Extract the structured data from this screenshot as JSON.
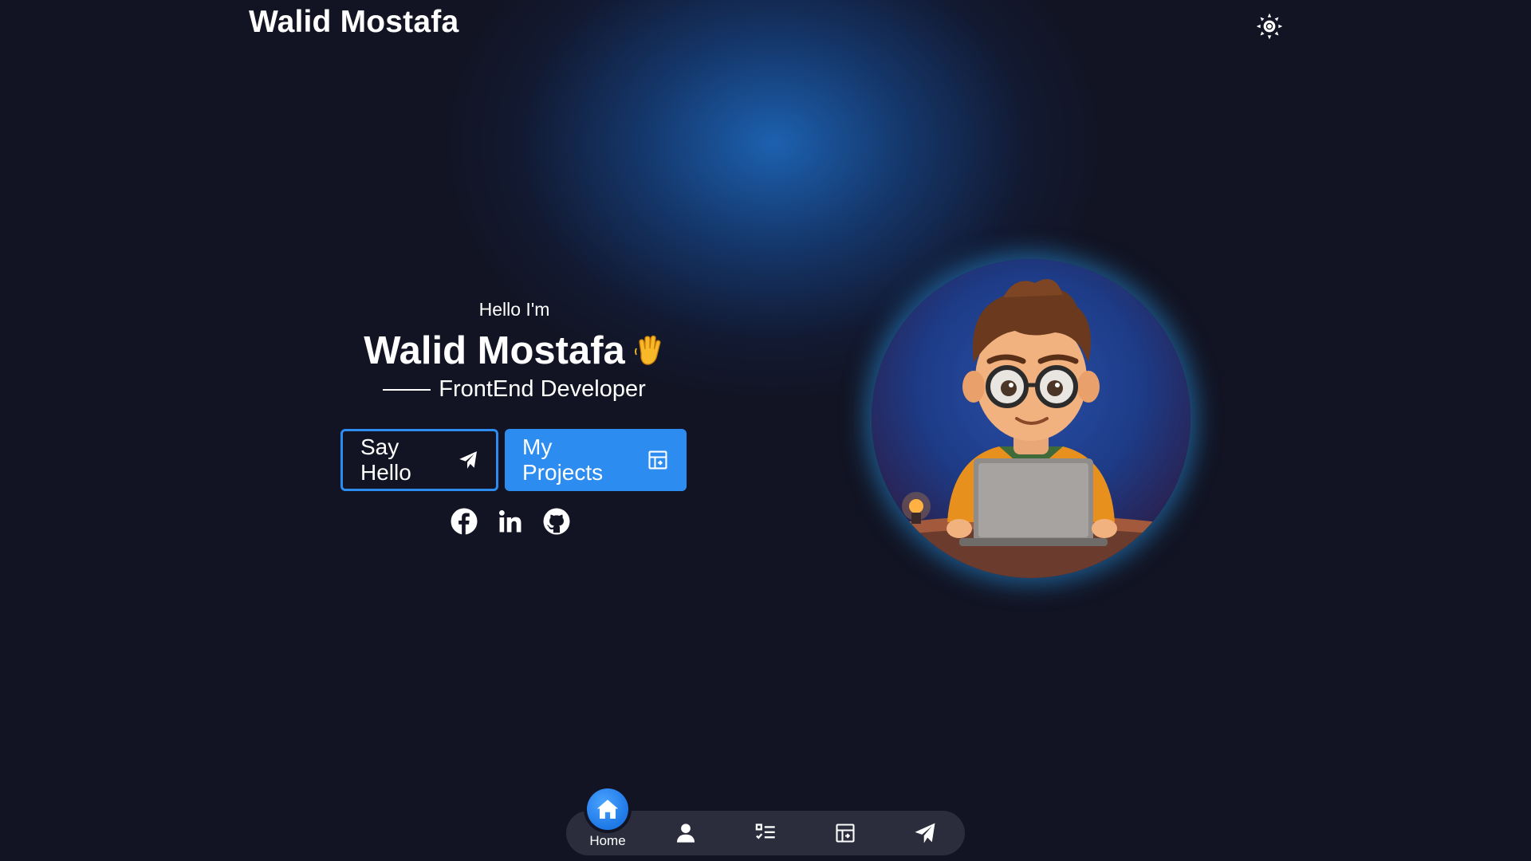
{
  "header": {
    "brand": "Walid Mostafa",
    "theme_toggle_icon": "sun-icon"
  },
  "hero": {
    "greeting": "Hello I'm",
    "name": "Walid Mostafa",
    "wave_icon": "waving-hand-icon",
    "role": "FrontEnd Developer",
    "buttons": [
      {
        "label": "Say Hello",
        "icon": "paper-plane-icon"
      },
      {
        "label": "My Projects",
        "icon": "projects-icon"
      }
    ],
    "socials": [
      "facebook-icon",
      "linkedin-icon",
      "github-icon"
    ]
  },
  "avatar": {
    "icon": "developer-avatar"
  },
  "bottom_nav": {
    "items": [
      {
        "label": "Home",
        "icon": "home-icon",
        "active": true
      },
      {
        "label": "",
        "icon": "user-icon"
      },
      {
        "label": "",
        "icon": "checklist-icon"
      },
      {
        "label": "",
        "icon": "projects-icon"
      },
      {
        "label": "",
        "icon": "paper-plane-icon"
      }
    ]
  },
  "colors": {
    "background": "#121423",
    "accent": "#2d8cf0",
    "nav_bg": "#2b2d3c"
  }
}
